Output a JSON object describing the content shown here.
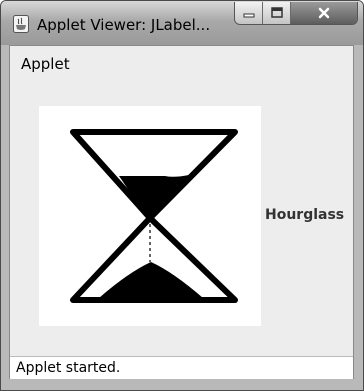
{
  "window": {
    "title": "Applet Viewer: JLabel..."
  },
  "menu": {
    "applet_label": "Applet"
  },
  "label": {
    "text": "Hourglass",
    "icon": "hourglass-icon"
  },
  "status": {
    "text": "Applet started."
  },
  "colors": {
    "client_background": "#ededed",
    "title_bar": "#a9a9a9",
    "image_background": "#ffffff"
  }
}
